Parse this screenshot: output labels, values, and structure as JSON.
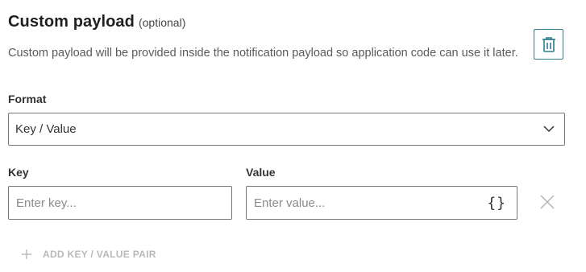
{
  "header": {
    "title": "Custom payload",
    "optional": "(optional)",
    "description": "Custom payload will be provided inside the notification payload so application code can use it later."
  },
  "icons": {
    "delete": "trash-icon",
    "dropdown": "chevron-down-icon",
    "json": "braces-icon",
    "remove": "close-icon",
    "add": "plus-icon"
  },
  "format": {
    "label": "Format",
    "value": "Key / Value"
  },
  "key_field": {
    "label": "Key",
    "placeholder": "Enter key..."
  },
  "value_field": {
    "label": "Value",
    "placeholder": "Enter value...",
    "braces": "{}"
  },
  "actions": {
    "add_pair_label": "ADD KEY / VALUE PAIR"
  },
  "colors": {
    "accent": "#2f7d8f",
    "border": "#777777",
    "muted": "#b9b9b9"
  }
}
